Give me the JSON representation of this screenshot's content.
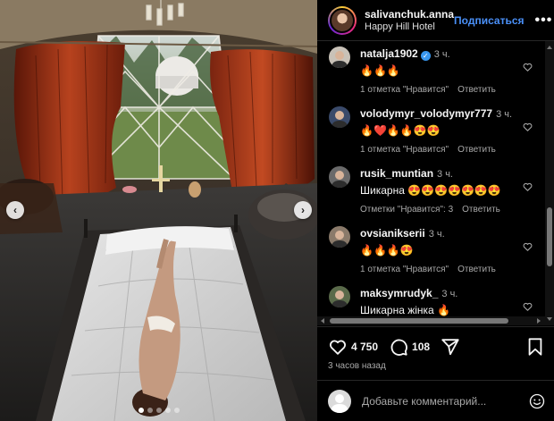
{
  "post": {
    "author": "salivanchuk.anna",
    "location": "Happy Hill Hotel",
    "follow_label": "Подписаться",
    "more_label": "•••"
  },
  "carousel": {
    "prev_label": "‹",
    "next_label": "›",
    "slide_count": 5,
    "active_slide": 1
  },
  "comments": [
    {
      "user": "natalja1902",
      "verified": true,
      "verified_mark": "✓",
      "time": "3 ч.",
      "text": "🔥🔥🔥",
      "likes": "1 отметка \"Нравится\"",
      "reply": "Ответить",
      "avatar_color": "#c9c2b8"
    },
    {
      "user": "volodymyr_volodymyr777",
      "verified": false,
      "time": "3 ч.",
      "text": "🔥❤️🔥🔥😍😍",
      "likes": "1 отметка \"Нравится\"",
      "reply": "Ответить",
      "avatar_color": "#3a4a6a"
    },
    {
      "user": "rusik_muntian",
      "verified": false,
      "time": "3 ч.",
      "text": "Шикарна 😍😍😍😍😍😍😍",
      "likes": "Отметки \"Нравится\": 3",
      "reply": "Ответить",
      "avatar_color": "#6a6a6a"
    },
    {
      "user": "ovsianikserii",
      "verified": false,
      "time": "3 ч.",
      "text": "🔥🔥🔥😍",
      "likes": "1 отметка \"Нравится\"",
      "reply": "Ответить",
      "avatar_color": "#8a7a6a"
    },
    {
      "user": "maksymrudyk_",
      "verified": false,
      "time": "3 ч.",
      "text": "Шикарна жінка 🔥",
      "likes": "",
      "reply": "",
      "avatar_color": "#5a6a4a"
    }
  ],
  "actions": {
    "like_count": "4 750",
    "comment_count": "108",
    "timestamp": "3 часов назад"
  },
  "add_comment": {
    "placeholder": "Добавьте комментарий..."
  },
  "colors": {
    "accent": "#4a90f8",
    "background": "#000000",
    "muted_text": "#a8a8a8"
  }
}
